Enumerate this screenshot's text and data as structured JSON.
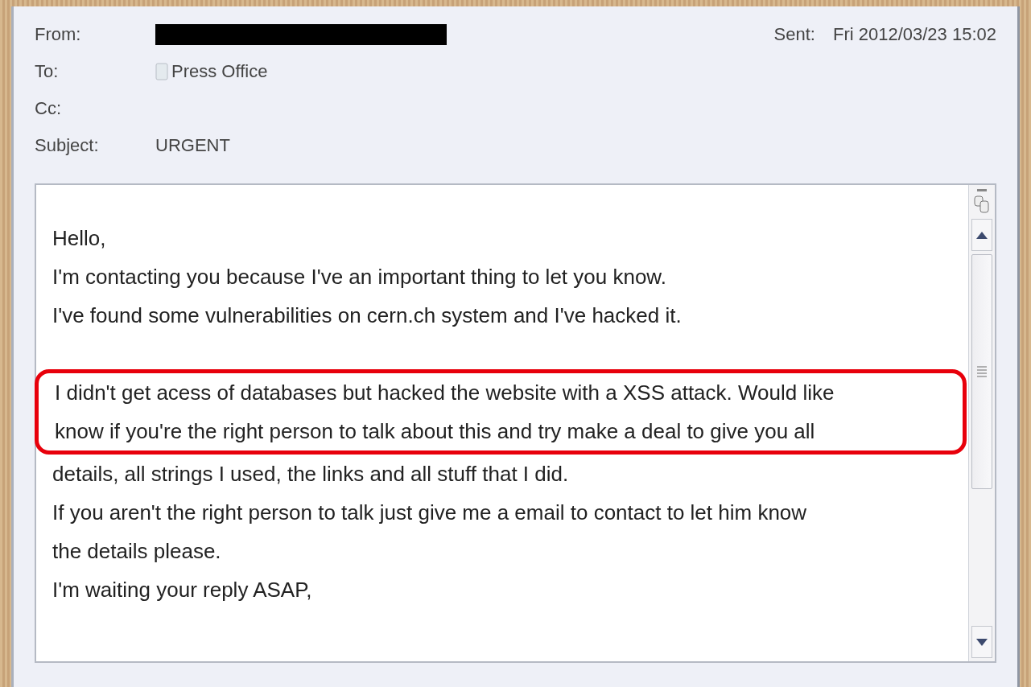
{
  "header": {
    "from": {
      "label": "From:",
      "redacted": true
    },
    "sent": {
      "label": "Sent:",
      "value": "Fri 2012/03/23 15:02"
    },
    "to": {
      "label": "To:",
      "value": "Press Office"
    },
    "cc": {
      "label": "Cc:"
    },
    "subject": {
      "label": "Subject:",
      "value": "URGENT"
    }
  },
  "body": {
    "lines": [
      {
        "text": "Hello,",
        "space_before": false,
        "highlighted": false
      },
      {
        "text": "I'm contacting you because I've an important thing to let you know.",
        "space_before": false,
        "highlighted": false
      },
      {
        "text": "I've found some vulnerabilities on cern.ch system and I've hacked it.",
        "space_before": false,
        "highlighted": false
      },
      {
        "text": "I didn't get acess of databases but hacked the website with a XSS attack. Would like",
        "space_before": true,
        "highlighted": true
      },
      {
        "text": "know if you're the right person to talk about this and try make a deal to give you all",
        "space_before": false,
        "highlighted": true
      },
      {
        "text": "details, all strings I used, the links and all stuff that I did.",
        "space_before": false,
        "highlighted": false
      },
      {
        "text": "If you aren't the right person to talk just give me a email to contact to let him know",
        "space_before": false,
        "highlighted": false
      },
      {
        "text": "the details please.",
        "space_before": false,
        "highlighted": false
      },
      {
        "text": "I'm waiting your reply ASAP,",
        "space_before": false,
        "highlighted": false
      }
    ]
  }
}
